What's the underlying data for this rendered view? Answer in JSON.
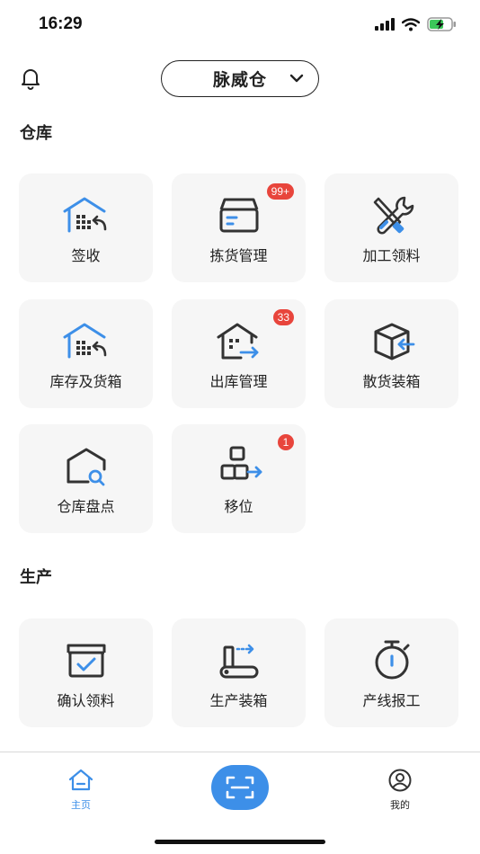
{
  "status_bar": {
    "time": "16:29"
  },
  "header": {
    "warehouse": "脉威仓"
  },
  "sections": {
    "warehouse": {
      "title": "仓库"
    },
    "production": {
      "title": "生产"
    }
  },
  "tiles": {
    "sign": {
      "label": "签收"
    },
    "picking": {
      "label": "拣货管理",
      "badge": "99+"
    },
    "processing": {
      "label": "加工领料"
    },
    "inventory": {
      "label": "库存及货箱"
    },
    "outbound": {
      "label": "出库管理",
      "badge": "33"
    },
    "bulk_packing": {
      "label": "散货装箱"
    },
    "stocktake": {
      "label": "仓库盘点"
    },
    "relocate": {
      "label": "移位",
      "badge": "1"
    },
    "confirm_material": {
      "label": "确认领料"
    },
    "production_packing": {
      "label": "生产装箱"
    },
    "line_report": {
      "label": "产线报工"
    }
  },
  "tabbar": {
    "home": {
      "label": "主页"
    },
    "mine": {
      "label": "我的"
    }
  },
  "colors": {
    "accent": "#3d8fe8",
    "badge": "#e8453c",
    "tile_bg": "#f6f6f6",
    "icon_dark": "#333333"
  }
}
